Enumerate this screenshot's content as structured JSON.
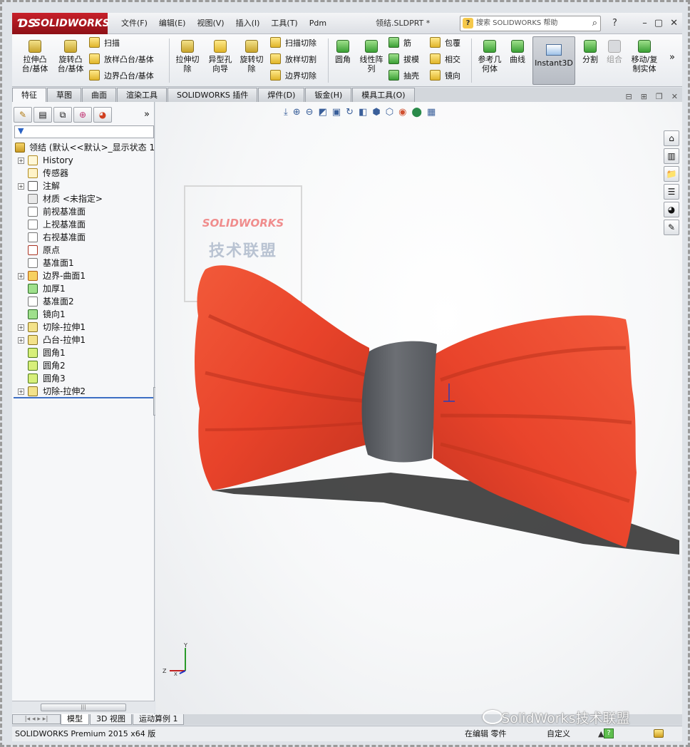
{
  "app": {
    "brand": "SOLIDWORKS",
    "document_title": "领结.SLDPRT *",
    "menu": [
      "文件(F)",
      "编辑(E)",
      "视图(V)",
      "插入(I)",
      "工具(T)",
      "Pdm"
    ],
    "search_placeholder": "搜索 SOLIDWORKS 帮助",
    "help_label": "?"
  },
  "toolbar": {
    "extrude_boss": "拉伸凸\n台/基体",
    "revolve_boss": "旋转凸\n台/基体",
    "sweep": "扫描",
    "loft_boss": "放样凸台/基体",
    "boundary_boss": "边界凸台/基体",
    "extrude_cut": "拉伸切\n除",
    "hole_wizard": "异型孔\n向导",
    "revolve_cut": "旋转切\n除",
    "sweep_cut": "扫描切除",
    "loft_cut": "放样切割",
    "boundary_cut": "边界切除",
    "fillet": "圆角",
    "linear_pattern": "线性阵\n列",
    "rib": "筋",
    "draft": "拔模",
    "shell": "抽壳",
    "wrap": "包覆",
    "intersect": "相交",
    "mirror": "镜向",
    "ref_geometry": "参考几\n何体",
    "curves": "曲线",
    "instant3d": "Instant3D",
    "split": "分割",
    "combine": "组合",
    "move_copy_body": "移动/复\n制实体"
  },
  "tabs": [
    "特征",
    "草图",
    "曲面",
    "渲染工具",
    "SOLIDWORKS 插件",
    "焊件(D)",
    "钣金(H)",
    "模具工具(O)"
  ],
  "feature_tree": {
    "root": "领结 (默认<<默认>_显示状态 1",
    "items": [
      {
        "label": "History",
        "icon": "history-icon",
        "expand": true
      },
      {
        "label": "传感器",
        "icon": "sensor-icon",
        "expand": false
      },
      {
        "label": "注解",
        "icon": "annotation-icon",
        "expand": true
      },
      {
        "label": "材质 <未指定>",
        "icon": "material-icon",
        "expand": false
      },
      {
        "label": "前视基准面",
        "icon": "plane-icon",
        "expand": false
      },
      {
        "label": "上视基准面",
        "icon": "plane-icon",
        "expand": false
      },
      {
        "label": "右视基准面",
        "icon": "plane-icon",
        "expand": false
      },
      {
        "label": "原点",
        "icon": "origin-icon",
        "expand": false
      },
      {
        "label": "基准面1",
        "icon": "plane-icon",
        "expand": false
      },
      {
        "label": "边界-曲面1",
        "icon": "boundary-surface-icon",
        "expand": true
      },
      {
        "label": "加厚1",
        "icon": "thicken-icon",
        "expand": false
      },
      {
        "label": "基准面2",
        "icon": "plane-icon",
        "expand": false
      },
      {
        "label": "镜向1",
        "icon": "mirror-icon",
        "expand": false
      },
      {
        "label": "切除-拉伸1",
        "icon": "cut-extrude-icon",
        "expand": true
      },
      {
        "label": "凸台-拉伸1",
        "icon": "boss-extrude-icon",
        "expand": true
      },
      {
        "label": "圆角1",
        "icon": "fillet-icon",
        "expand": false
      },
      {
        "label": "圆角2",
        "icon": "fillet-icon",
        "expand": false
      },
      {
        "label": "圆角3",
        "icon": "fillet-icon",
        "expand": false
      },
      {
        "label": "切除-拉伸2",
        "icon": "cut-extrude-icon",
        "expand": true
      }
    ]
  },
  "watermark": {
    "brand": "SOLIDWORKS",
    "text": "技术联盟"
  },
  "triad": {
    "x": "X",
    "y": "Y",
    "z": "Z"
  },
  "bottom_tabs": [
    "模型",
    "3D 视图",
    "运动算例 1"
  ],
  "status": {
    "product": "SOLIDWORKS Premium 2015 x64 版",
    "mode": "在编辑 零件",
    "units": "自定义",
    "units_arrow": "▲",
    "rebuild_icon": "?"
  },
  "footer_watermark": "SolidWorks技术联盟",
  "colors": {
    "bow_red": "#ee4b2b",
    "knot_gray": "#5e6166",
    "brand_red": "#c8202a"
  }
}
